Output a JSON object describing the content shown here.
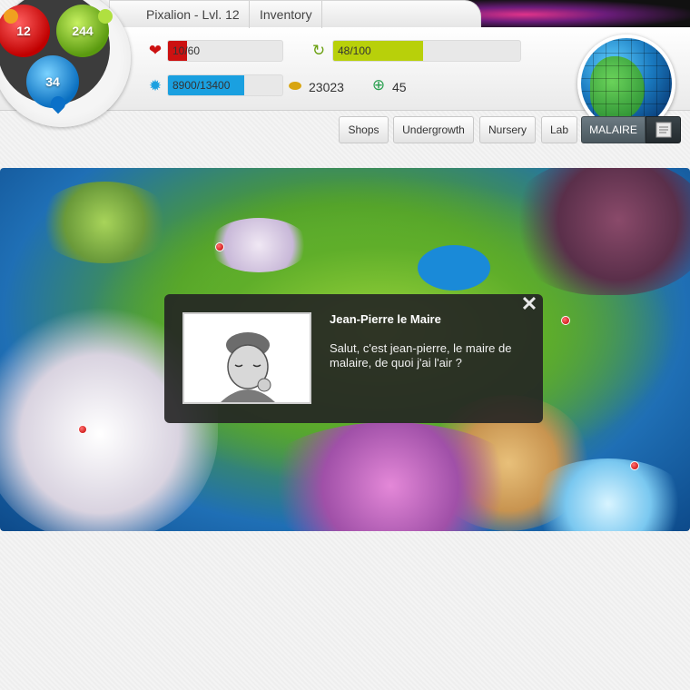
{
  "header": {
    "title_tab": "Pixalion - Lvl. 12",
    "inventory_tab": "Inventory"
  },
  "orbs": {
    "red": "12",
    "green": "244",
    "blue": "34"
  },
  "stats": {
    "health": {
      "text": "10/60",
      "fraction": 0.1667,
      "color": "#cc1111"
    },
    "energy": {
      "text": "48/100",
      "fraction": 0.48,
      "color": "#b8d00a"
    },
    "xp": {
      "text": "8900/13400",
      "fraction": 0.664,
      "color": "#1aa0e0"
    },
    "gold": "23023",
    "gems": "45"
  },
  "nav": {
    "shops": "Shops",
    "undergrowth": "Undergrowth",
    "nursery": "Nursery",
    "lab": "Lab",
    "location": "MALAIRE"
  },
  "dialog": {
    "npc_name": "Jean-Pierre le Maire",
    "message": "Salut, c'est jean-pierre, le maire de malaire, de quoi j'ai l'air ?",
    "close_symbol": "✕"
  },
  "icons": {
    "health": "heart-icon",
    "energy": "energy-swirl-icon",
    "xp": "star-burst-icon",
    "gold": "gold-coins-icon",
    "gems": "green-gem-icon",
    "scroll": "scroll-icon"
  }
}
